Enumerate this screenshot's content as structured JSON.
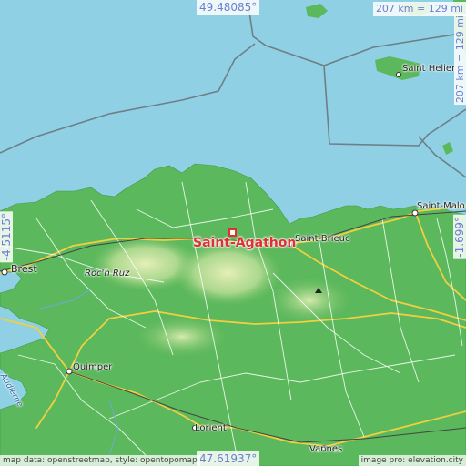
{
  "coordinates": {
    "north": "49.48085°",
    "south": "47.61937°",
    "west": "-4.5115°",
    "east": "-1.699°"
  },
  "scale": {
    "horizontal": "207 km = 129 mi",
    "vertical": "207 km = 129 mi"
  },
  "attribution": {
    "left": "map data: openstreetmap, style: opentopomap",
    "right": "image pro: elevation.city"
  },
  "main_place": "Saint-Agathon",
  "places": {
    "brest": "Brest",
    "rochruz": "Roc'h Ruz",
    "quimper": "Quimper",
    "lorient": "Lorient",
    "vannes": "Vannes",
    "saintbrieuc": "Saint-Brieuc",
    "saintmalo": "Saint-Malo",
    "sainthelier": "Saint Helier",
    "audierne": "Audierne"
  },
  "colors": {
    "sea": "#8fd0e4",
    "land": "#5cb85c",
    "highland": "#cfe6a0",
    "marker": "#e03030",
    "coord_text": "#6b7fd0"
  }
}
